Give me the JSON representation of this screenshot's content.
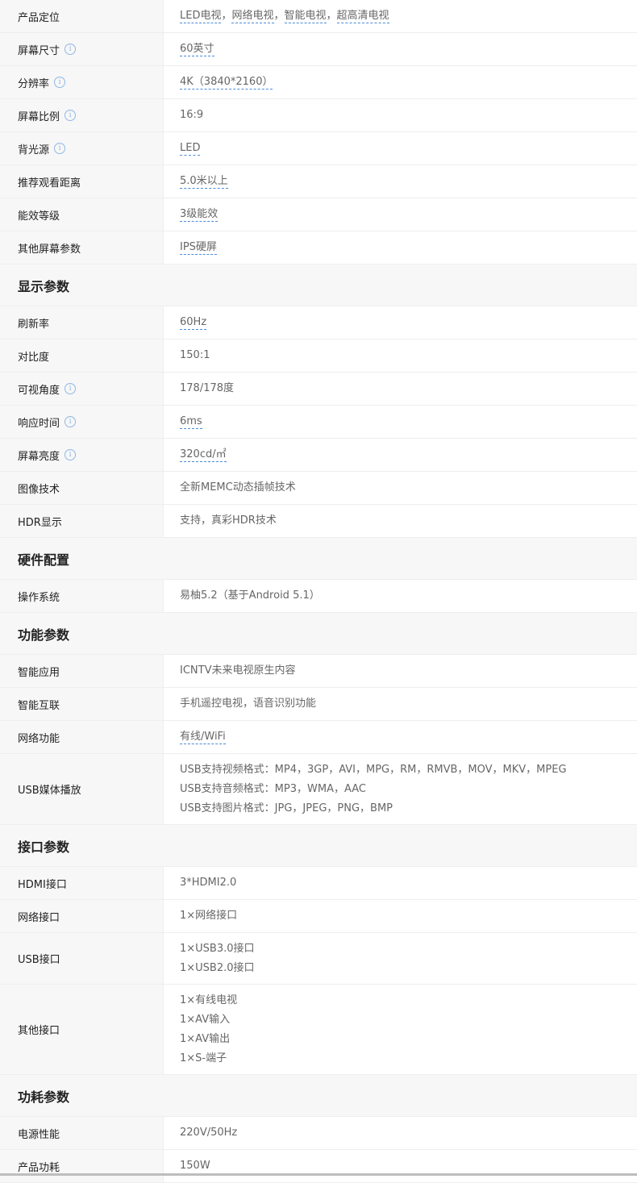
{
  "spec_table": {
    "rows": [
      {
        "kind": "row",
        "label": "产品定位",
        "info": false,
        "lines": [
          [
            "LED电视",
            "网络电视",
            "智能电视",
            "超高清电视"
          ]
        ],
        "links": true
      },
      {
        "kind": "row",
        "label": "屏幕尺寸",
        "info": true,
        "lines": [
          [
            "60英寸"
          ]
        ],
        "links": true
      },
      {
        "kind": "row",
        "label": "分辨率",
        "info": true,
        "lines": [
          [
            "4K（3840*2160）"
          ]
        ],
        "links": true
      },
      {
        "kind": "row",
        "label": "屏幕比例",
        "info": true,
        "lines": [
          [
            "16:9"
          ]
        ],
        "links": false
      },
      {
        "kind": "row",
        "label": "背光源",
        "info": true,
        "lines": [
          [
            "LED"
          ]
        ],
        "links": true
      },
      {
        "kind": "row",
        "label": "推荐观看距离",
        "info": false,
        "lines": [
          [
            "5.0米以上"
          ]
        ],
        "links": true
      },
      {
        "kind": "row",
        "label": "能效等级",
        "info": false,
        "lines": [
          [
            "3级能效"
          ]
        ],
        "links": true
      },
      {
        "kind": "row",
        "label": "其他屏幕参数",
        "info": false,
        "lines": [
          [
            "IPS硬屏"
          ]
        ],
        "links": true
      },
      {
        "kind": "section",
        "label": "显示参数"
      },
      {
        "kind": "row",
        "label": "刷新率",
        "info": false,
        "lines": [
          [
            "60Hz"
          ]
        ],
        "links": true
      },
      {
        "kind": "row",
        "label": "对比度",
        "info": false,
        "lines": [
          [
            "150:1"
          ]
        ],
        "links": false
      },
      {
        "kind": "row",
        "label": "可视角度",
        "info": true,
        "lines": [
          [
            "178/178度"
          ]
        ],
        "links": false
      },
      {
        "kind": "row",
        "label": "响应时间",
        "info": true,
        "lines": [
          [
            "6ms"
          ]
        ],
        "links": true
      },
      {
        "kind": "row",
        "label": "屏幕亮度",
        "info": true,
        "lines": [
          [
            "320cd/㎡"
          ]
        ],
        "links": true
      },
      {
        "kind": "row",
        "label": "图像技术",
        "info": false,
        "lines": [
          [
            "全新MEMC动态插帧技术"
          ]
        ],
        "links": false
      },
      {
        "kind": "row",
        "label": "HDR显示",
        "info": false,
        "lines": [
          [
            "支持，真彩HDR技术"
          ]
        ],
        "links": false
      },
      {
        "kind": "section",
        "label": "硬件配置"
      },
      {
        "kind": "row",
        "label": "操作系统",
        "info": false,
        "lines": [
          [
            "易柚5.2（基于Android 5.1）"
          ]
        ],
        "links": false
      },
      {
        "kind": "section",
        "label": "功能参数"
      },
      {
        "kind": "row",
        "label": "智能应用",
        "info": false,
        "lines": [
          [
            "ICNTV未来电视原生内容"
          ]
        ],
        "links": false
      },
      {
        "kind": "row",
        "label": "智能互联",
        "info": false,
        "lines": [
          [
            "手机遥控电视，语音识别功能"
          ]
        ],
        "links": false
      },
      {
        "kind": "row",
        "label": "网络功能",
        "info": false,
        "lines": [
          [
            "有线/WiFi"
          ]
        ],
        "links": true
      },
      {
        "kind": "row",
        "label": "USB媒体播放",
        "info": false,
        "lines": [
          [
            "USB支持视频格式：MP4，3GP，AVI，MPG，RM，RMVB，MOV，MKV，MPEG"
          ],
          [
            "USB支持音频格式：MP3，WMA，AAC"
          ],
          [
            "USB支持图片格式：JPG，JPEG，PNG，BMP"
          ]
        ],
        "links": false
      },
      {
        "kind": "section",
        "label": "接口参数"
      },
      {
        "kind": "row",
        "label": "HDMI接口",
        "info": false,
        "lines": [
          [
            "3*HDMI2.0"
          ]
        ],
        "links": false
      },
      {
        "kind": "row",
        "label": "网络接口",
        "info": false,
        "lines": [
          [
            "1×网络接口"
          ]
        ],
        "links": false
      },
      {
        "kind": "row",
        "label": "USB接口",
        "info": false,
        "lines": [
          [
            "1×USB3.0接口"
          ],
          [
            "1×USB2.0接口"
          ]
        ],
        "links": false
      },
      {
        "kind": "row",
        "label": "其他接口",
        "info": false,
        "lines": [
          [
            "1×有线电视"
          ],
          [
            "1×AV输入"
          ],
          [
            "1×AV输出"
          ],
          [
            "1×S-端子"
          ]
        ],
        "links": false
      },
      {
        "kind": "section",
        "label": "功耗参数"
      },
      {
        "kind": "row",
        "label": "电源性能",
        "info": false,
        "lines": [
          [
            "220V/50Hz"
          ]
        ],
        "links": false
      },
      {
        "kind": "row",
        "label": "产品功耗",
        "info": false,
        "lines": [
          [
            "150W"
          ]
        ],
        "links": false
      }
    ],
    "info_icon_glyph": "i",
    "link_color": "#4a8bd8"
  }
}
